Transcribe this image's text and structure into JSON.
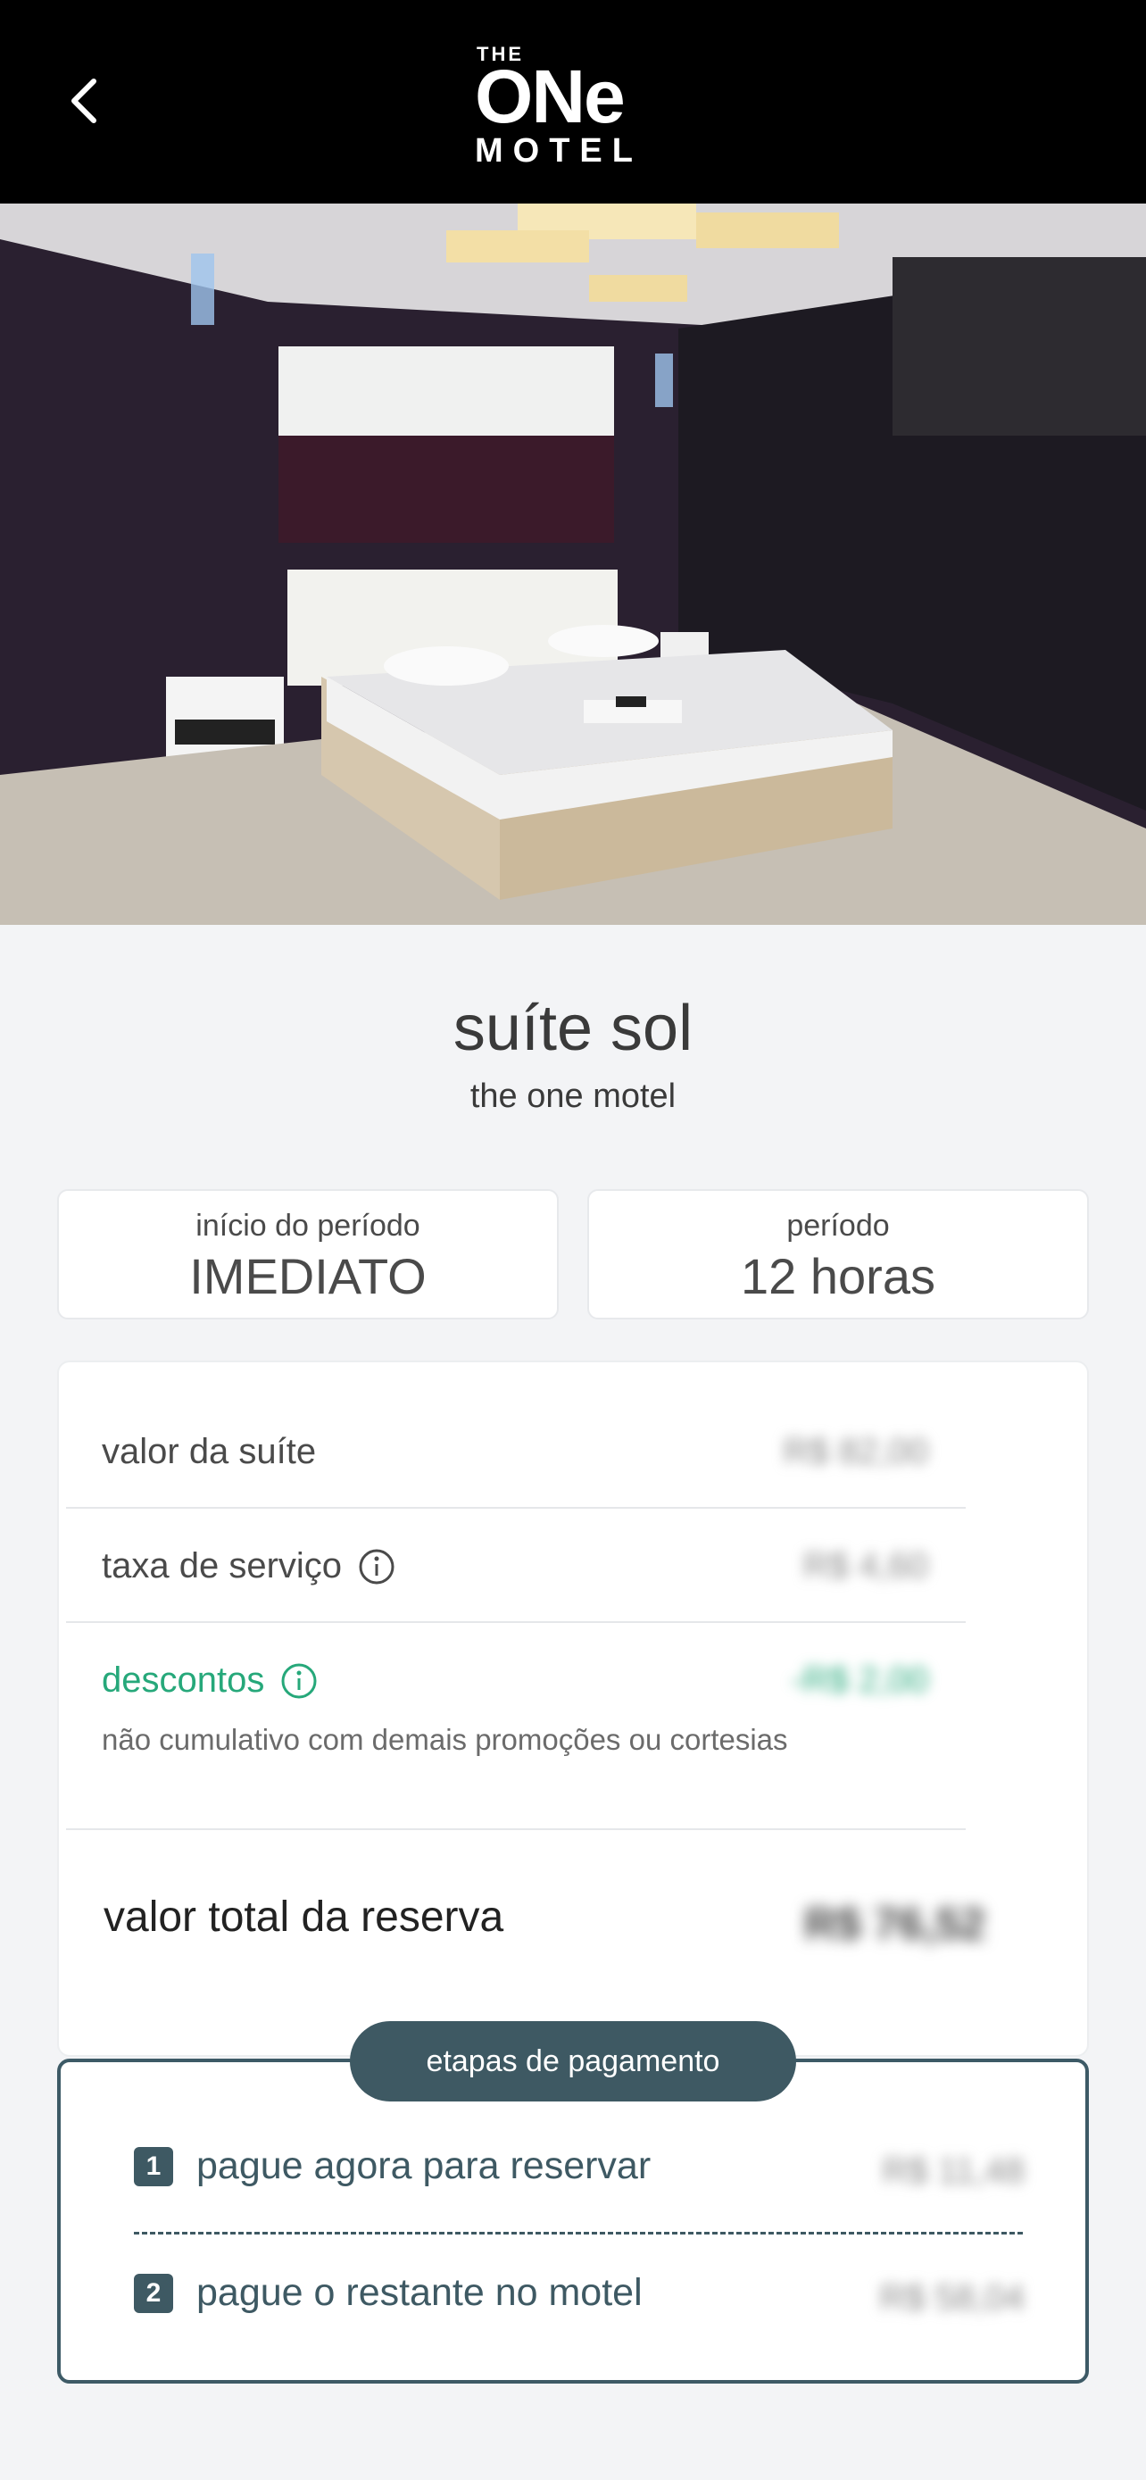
{
  "header": {
    "logo_top": "THE",
    "logo_main": "ONe",
    "logo_bottom": "MOTEL"
  },
  "suite": {
    "title": "suíte sol",
    "subtitle": "the one motel"
  },
  "info": {
    "start_label": "início do período",
    "start_value": "IMEDIATO",
    "period_label": "período",
    "period_value": "12 horas"
  },
  "pricing": {
    "suite_label": "valor da suíte",
    "suite_amount": "R$ 82,00",
    "fee_label": "taxa de serviço",
    "fee_amount": "R$ 4,60",
    "discount_label": "descontos",
    "discount_amount": "-R$ 2,00",
    "discount_note": "não cumulativo com demais promoções ou cortesias",
    "total_label": "valor total da reserva",
    "total_amount": "R$ 76,52"
  },
  "payment": {
    "title": "etapas de pagamento",
    "steps": [
      {
        "number": "1",
        "label": "pague agora para reservar",
        "amount": "R$ 11,48"
      },
      {
        "number": "2",
        "label": "pague o restante no motel",
        "amount": "R$ 58,04"
      }
    ]
  },
  "colors": {
    "header_bg": "#000000",
    "accent_dark": "#3e5963",
    "discount_green": "#26a87a"
  }
}
